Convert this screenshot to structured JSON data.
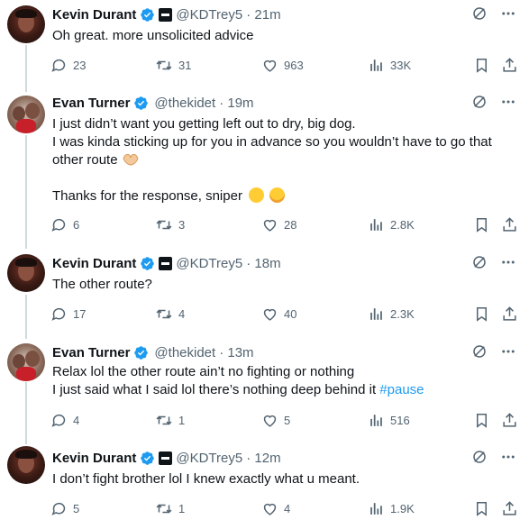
{
  "tweets": [
    {
      "name": "Kevin Durant",
      "handle": "@KDTrey5",
      "time": "· 21m",
      "lines": [
        "Oh great. more unsolicited advice"
      ],
      "replies": "23",
      "retweets": "31",
      "likes": "963",
      "views": "33K"
    },
    {
      "name": "Evan Turner",
      "handle": "@thekidet",
      "time": "· 19m",
      "lines": [
        "I just didn’t want you getting left out to dry, big dog.",
        "I was kinda sticking up for you in advance so you wouldn’t have to go that",
        "other route",
        "Thanks for the response, sniper"
      ],
      "replies": "6",
      "retweets": "3",
      "likes": "28",
      "views": "2.8K"
    },
    {
      "name": "Kevin Durant",
      "handle": "@KDTrey5",
      "time": "· 18m",
      "lines": [
        "The other route?"
      ],
      "replies": "17",
      "retweets": "4",
      "likes": "40",
      "views": "2.3K"
    },
    {
      "name": "Evan Turner",
      "handle": "@thekidet",
      "time": "· 13m",
      "lines": [
        "Relax lol the other route ain’t no fighting or nothing",
        "I just said what I said lol there’s nothing deep behind it"
      ],
      "hashtag": "#pause",
      "replies": "4",
      "retweets": "1",
      "likes": "5",
      "views": "516"
    },
    {
      "name": "Kevin Durant",
      "handle": "@KDTrey5",
      "time": "· 12m",
      "lines": [
        "I don’t fight brother lol I knew exactly what u meant."
      ],
      "replies": "5",
      "retweets": "1",
      "likes": "4",
      "views": "1.9K"
    }
  ],
  "colors": {
    "verified": "#1d9bf0",
    "muted": "#536471",
    "text": "#0f1419",
    "hashtag": "#1d9bf0",
    "thread_line": "#cfd9de"
  },
  "icons": [
    "reply-icon",
    "retweet-icon",
    "like-icon",
    "views-icon",
    "bookmark-icon",
    "share-icon",
    "grok-icon",
    "more-icon",
    "verified-icon"
  ]
}
